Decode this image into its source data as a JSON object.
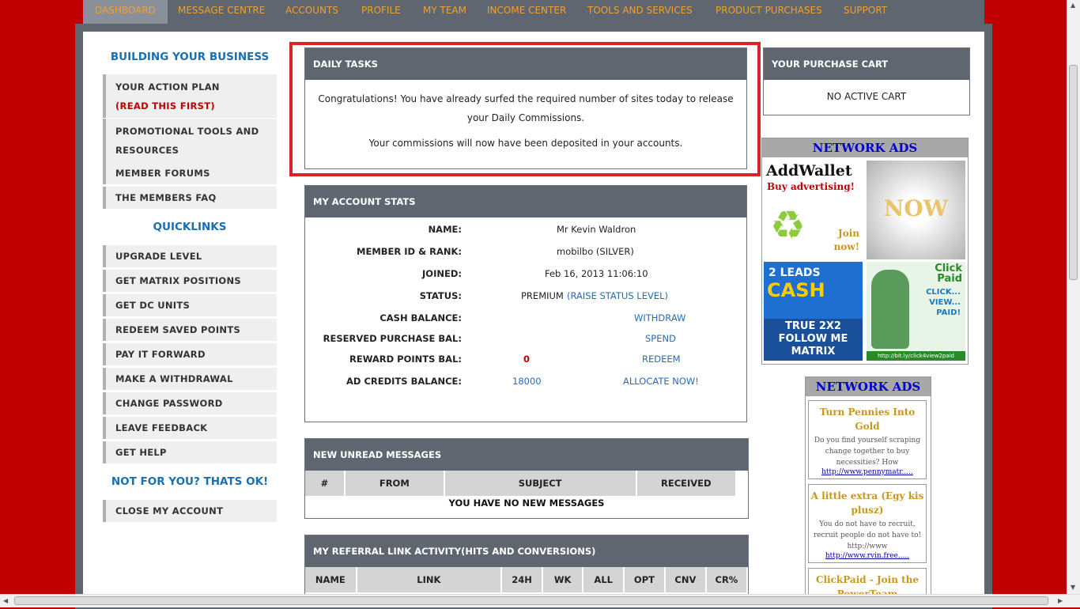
{
  "nav": {
    "items": [
      "DASHBOARD",
      "MESSAGE CENTRE",
      "ACCOUNTS",
      "PROFILE",
      "MY TEAM",
      "INCOME CENTER",
      "TOOLS AND SERVICES",
      "PRODUCT PURCHASES",
      "SUPPORT"
    ]
  },
  "sidebar": {
    "building_heading": "BUILDING YOUR BUSINESS",
    "action_plan": "YOUR ACTION PLAN",
    "action_plan_note": "(READ THIS FIRST)",
    "promo_line1": "PROMOTIONAL TOOLS AND",
    "promo_line2": "RESOURCES",
    "forums": "MEMBER FORUMS",
    "faq": "THE MEMBERS FAQ",
    "quicklinks_heading": "QUICKLINKS",
    "quicklinks": [
      "UPGRADE LEVEL",
      "GET MATRIX POSITIONS",
      "GET DC UNITS",
      "REDEEM SAVED POINTS",
      "PAY IT FORWARD",
      "MAKE A WITHDRAWAL",
      "CHANGE PASSWORD",
      "LEAVE FEEDBACK",
      "GET HELP"
    ],
    "not_for_you_heading": "NOT FOR YOU? THATS OK!",
    "close_account": "CLOSE MY ACCOUNT"
  },
  "daily_tasks": {
    "title": "DAILY TASKS",
    "line1": "Congratulations! You have already surfed the required number of sites today to release",
    "line2": "your Daily Commissions.",
    "line3": "Your commissions will now have been deposited in your accounts."
  },
  "account_stats": {
    "title": "MY ACCOUNT STATS",
    "name_label": "NAME:",
    "name": "Mr Kevin Waldron",
    "member_label": "MEMBER ID & RANK:",
    "member": "mobilbo (SILVER)",
    "joined_label": "JOINED:",
    "joined": "Feb 16, 2013 11:06:10",
    "status_label": "STATUS:",
    "status": "PREMIUM",
    "status_link": "(RAISE STATUS LEVEL)",
    "cash_label": "CASH BALANCE:",
    "cash_link": "WITHDRAW",
    "reserved_label": "RESERVED PURCHASE BAL:",
    "reserved_link": "SPEND",
    "reward_label": "REWARD POINTS BAL:",
    "reward": "0",
    "reward_link": "REDEEM",
    "adcredits_label": "AD CREDITS BALANCE:",
    "adcredits": "18000",
    "adcredits_link": "ALLOCATE NOW!"
  },
  "messages": {
    "title": "NEW UNREAD MESSAGES",
    "columns": [
      "#",
      "FROM",
      "SUBJECT",
      "RECEIVED"
    ],
    "empty": "YOU HAVE NO NEW MESSAGES"
  },
  "referral": {
    "title": "MY REFERRAL LINK ACTIVITY(HITS AND CONVERSIONS)",
    "columns": [
      "NAME",
      "LINK",
      "24H",
      "WK",
      "ALL",
      "OPT",
      "CNV",
      "CR%"
    ]
  },
  "cart": {
    "title": "YOUR PURCHASE CART",
    "empty": "NO ACTIVE CART"
  },
  "network_ads": {
    "title": "NETWORK ADS",
    "banner1": {
      "brand": "AddWallet",
      "line1": "Buy advertising!",
      "line2": "Join",
      "line3": "now!"
    },
    "banner2": {
      "text": "NOW"
    },
    "banner3": {
      "line1": "2 LEADS",
      "line2": "CASH",
      "line3": "TRUE 2X2",
      "line4": "FOLLOW ME",
      "line5": "MATRIX"
    },
    "banner4": {
      "brand1": "Click",
      "brand2": "Paid",
      "line1": "CLICK...",
      "line2": "VIEW...",
      "line3": "PAID!",
      "footer": "http://bit.ly/click4view2paid"
    }
  },
  "network_ads_text": {
    "title": "NETWORK ADS",
    "ads": [
      {
        "title": "Turn Pennies Into Gold",
        "desc": "Do you find yourself scraping change together to buy necessities? How",
        "url": "http://www.pennymatr....."
      },
      {
        "title": "A little extra (Egy kis plusz)",
        "desc": "You do not have to recruit, recruit people do not have to! http://www",
        "url": "http://www.rvin.free....."
      },
      {
        "title": "ClickPaid - Join the PowerTeam",
        "desc": "",
        "url": ""
      }
    ]
  }
}
